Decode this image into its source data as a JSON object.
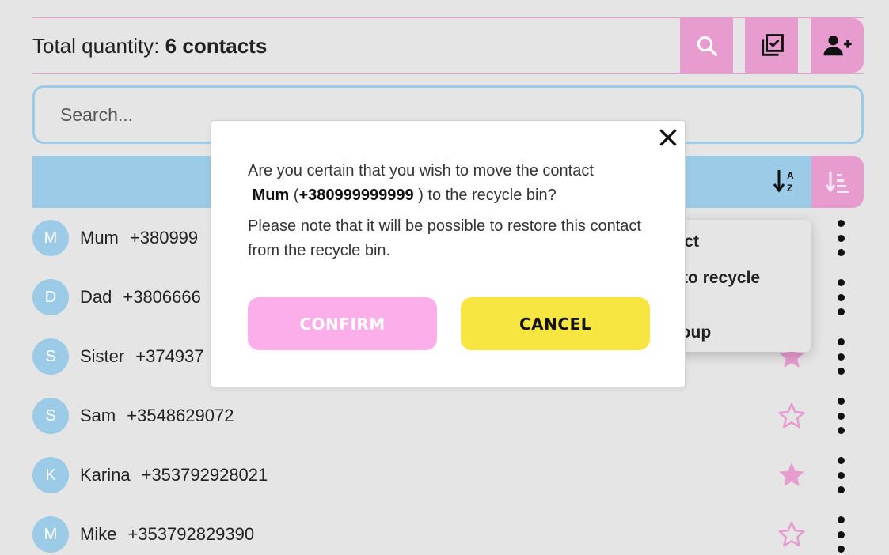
{
  "header": {
    "title_prefix": "Total quantity:",
    "title_count": "6 contacts"
  },
  "search": {
    "placeholder": "Search..."
  },
  "icons": {
    "search": "search-icon",
    "select": "select-all-icon",
    "add_user": "add-user-icon",
    "sort_az": "sort-alpha-icon",
    "sort_order": "sort-order-icon",
    "star_filled": "star-filled-icon",
    "star_outline": "star-outline-icon",
    "kebab": "more-vert-icon",
    "close": "close-icon"
  },
  "colors": {
    "pink": "#e79bcf",
    "blue": "#9bcbe6",
    "confirm": "#fbaee9",
    "cancel": "#f7e542"
  },
  "contacts": [
    {
      "initial": "M",
      "name": "Mum",
      "phone": "+380999",
      "favorite": false
    },
    {
      "initial": "D",
      "name": "Dad",
      "phone": "+3806666",
      "favorite": false
    },
    {
      "initial": "S",
      "name": "Sister",
      "phone": "+374937",
      "favorite": true
    },
    {
      "initial": "S",
      "name": "Sam",
      "phone": "+3548629072",
      "favorite": false
    },
    {
      "initial": "K",
      "name": "Karina",
      "phone": "+353792928021",
      "favorite": true
    },
    {
      "initial": "M",
      "name": "Mike",
      "phone": "+353792829390",
      "favorite": false
    }
  ],
  "context_menu": {
    "items": [
      "ontact",
      "ove to recycle",
      "o group"
    ]
  },
  "modal": {
    "line1": "Are you certain that you wish to move the contact",
    "contact_name": "Mum",
    "open_paren": "(",
    "contact_phone": "+380999999999",
    "line2_suffix": ") to the recycle bin?",
    "note": "Please note that it will be possible to restore this contact from the recycle bin.",
    "confirm_label": "CONFIRM",
    "cancel_label": "CANCEL"
  }
}
